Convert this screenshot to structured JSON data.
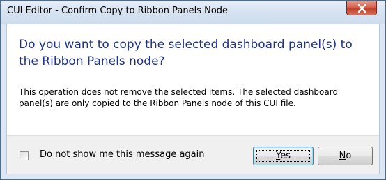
{
  "window": {
    "title": "CUI Editor - Confirm Copy to Ribbon Panels Node"
  },
  "dialog": {
    "main_instruction": "Do you want to copy the selected dashboard panel(s) to the Ribbon Panels node?",
    "content": "This operation does not remove the selected items. The selected dashboard panel(s) are only copied to the Ribbon Panels node of this CUI file."
  },
  "footer": {
    "checkbox_label": "Do not show me this message again",
    "checkbox_checked": false,
    "yes_access_key": "Y",
    "yes_rest": "es",
    "no_access_key": "N",
    "no_rest": "o",
    "default_button": "Yes"
  },
  "icons": {
    "close": "close-icon"
  }
}
